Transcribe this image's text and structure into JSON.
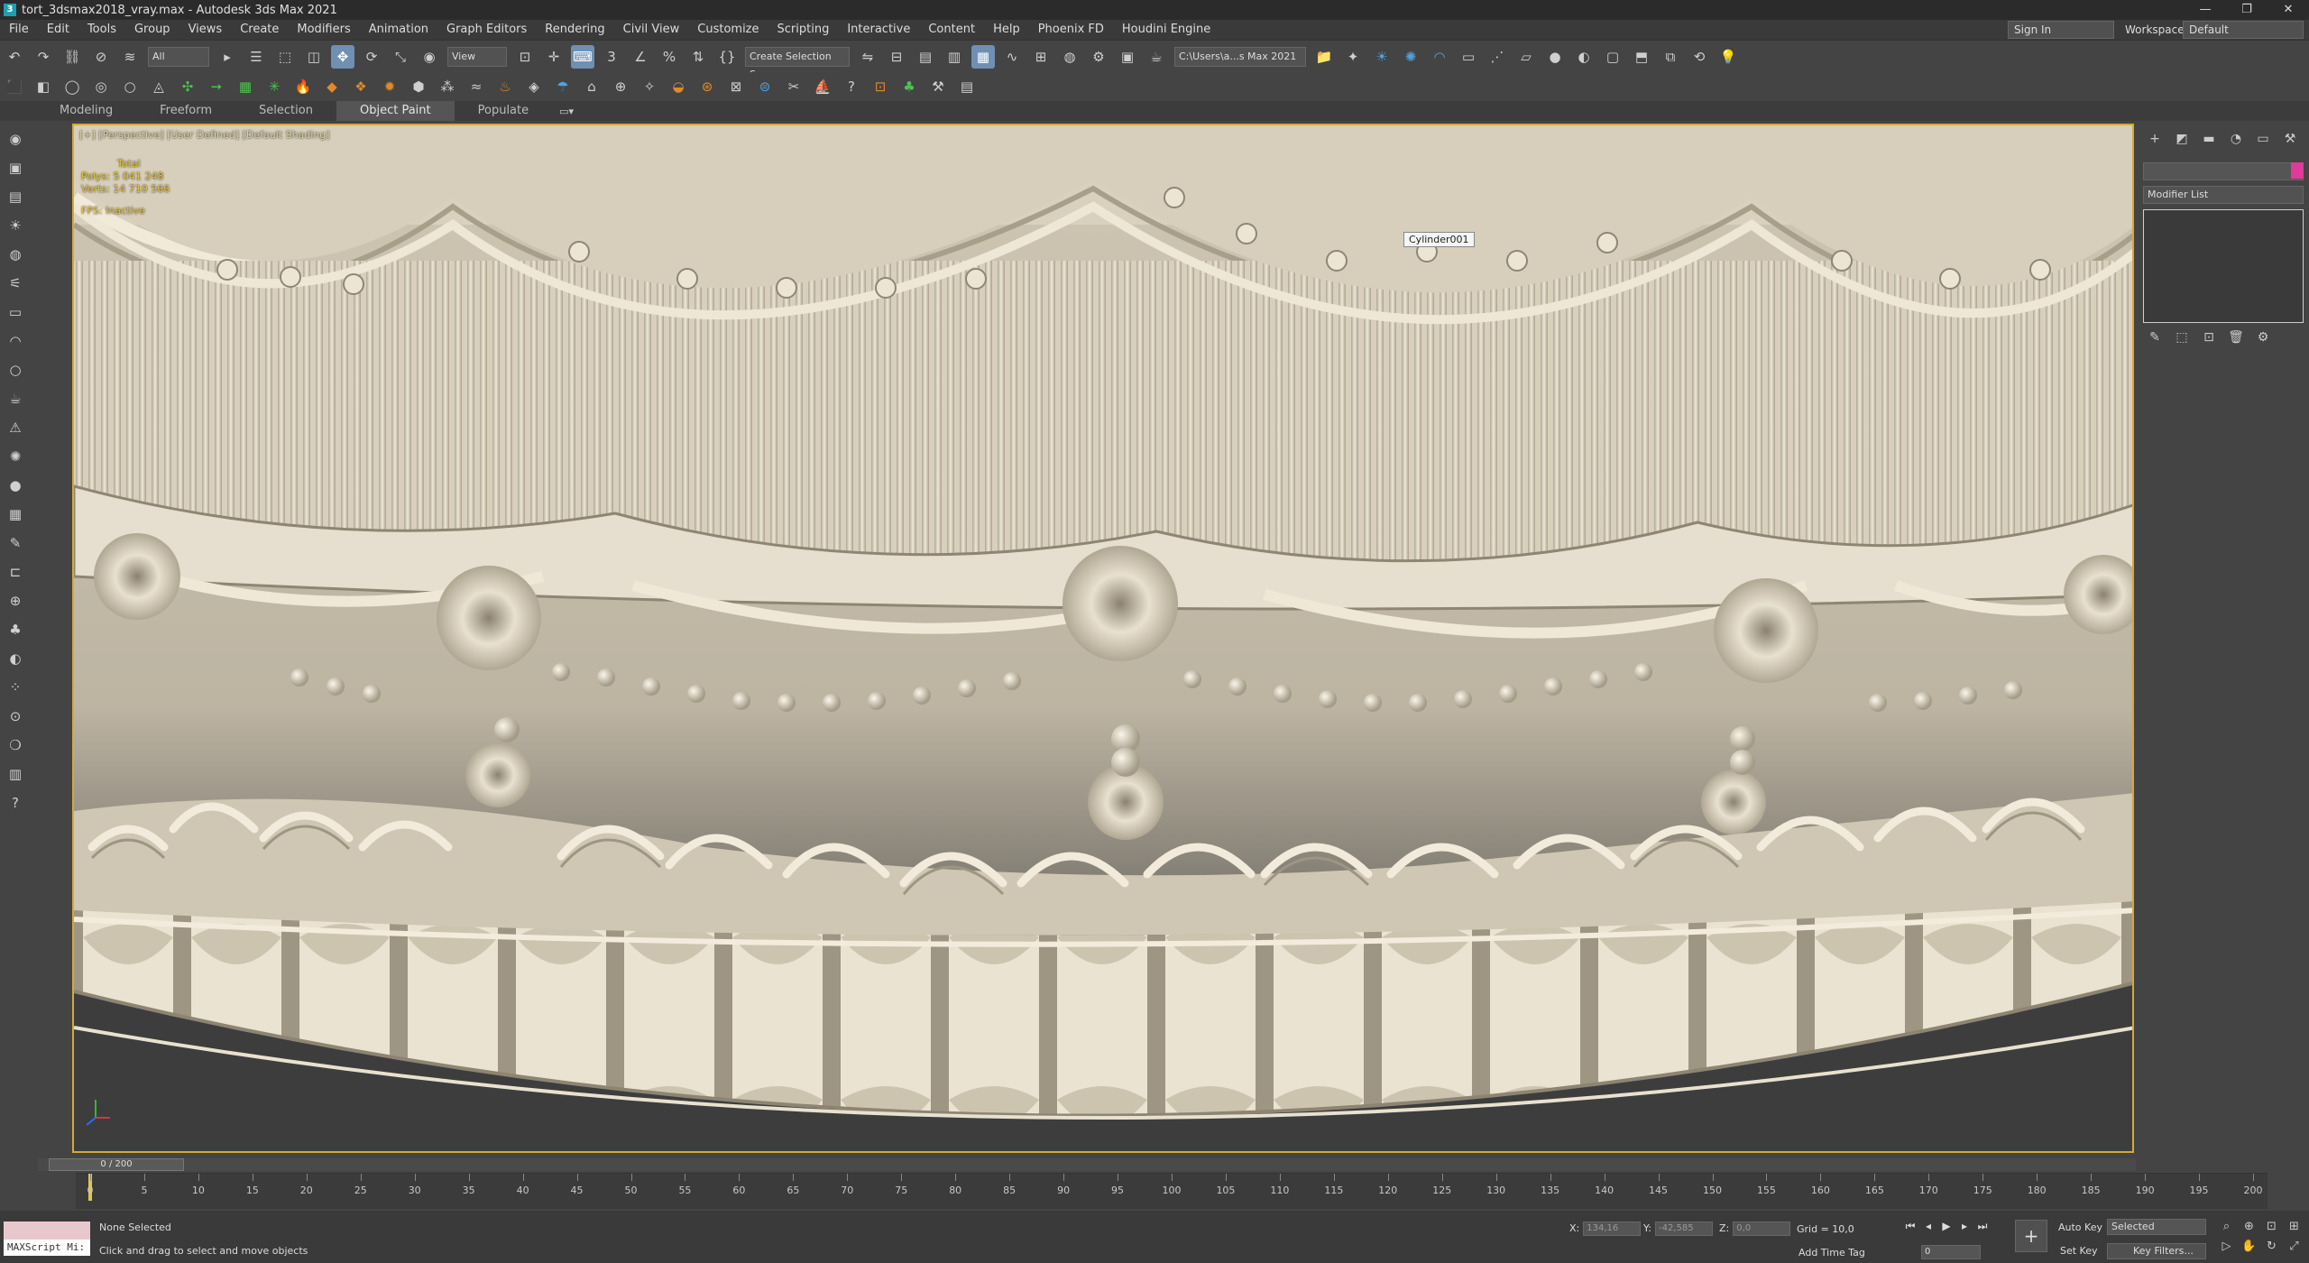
{
  "window": {
    "title": "tort_3dsmax2018_vray.max - Autodesk 3ds Max 2021",
    "controls": [
      "—",
      "❐",
      "✕"
    ]
  },
  "menu": [
    "File",
    "Edit",
    "Tools",
    "Group",
    "Views",
    "Create",
    "Modifiers",
    "Animation",
    "Graph Editors",
    "Rendering",
    "Civil View",
    "Customize",
    "Scripting",
    "Interactive",
    "Content",
    "Help",
    "Phoenix FD",
    "Houdini Engine"
  ],
  "account": {
    "signin": "Sign In",
    "workspaces_label": "Workspaces:",
    "workspace": "Default"
  },
  "toolbar": {
    "selection_filter": "All",
    "reference_coord": "View",
    "named_selection": "Create Selection Se",
    "project_path": "C:\\Users\\a...s Max 2021"
  },
  "ribbon": {
    "tabs": [
      "Modeling",
      "Freeform",
      "Selection",
      "Object Paint",
      "Populate"
    ],
    "active": "Object Paint"
  },
  "viewport": {
    "label": "[+] [Perspective] [User Defined] [Default Shading]",
    "stats": {
      "total_label": "Total",
      "polys_label": "Polys:",
      "polys_value": "5 041 248",
      "verts_label": "Verts:",
      "verts_value": "14 710 566",
      "fps_label": "FPS:",
      "fps_value": "Inactive"
    },
    "tooltip": "Cylinder001"
  },
  "command_panel": {
    "modifier_list": "Modifier List"
  },
  "timeline": {
    "frame_display": "0 / 200",
    "ticks": [
      "0",
      "5",
      "10",
      "15",
      "20",
      "25",
      "30",
      "35",
      "40",
      "45",
      "50",
      "55",
      "60",
      "65",
      "70",
      "75",
      "80",
      "85",
      "90",
      "95",
      "100",
      "105",
      "110",
      "115",
      "120",
      "125",
      "130",
      "135",
      "140",
      "145",
      "150",
      "155",
      "160",
      "165",
      "170",
      "175",
      "180",
      "185",
      "190",
      "195",
      "200"
    ]
  },
  "status": {
    "maxscript": "MAXScript Mi:",
    "selection": "None Selected",
    "hint": "Click and drag to select and move objects",
    "x_label": "X:",
    "x_value": "134,16",
    "y_label": "Y:",
    "y_value": "-42,585",
    "z_label": "Z:",
    "z_value": "0,0",
    "grid": "Grid = 10,0",
    "add_time_tag": "Add Time Tag",
    "frame": "0",
    "auto_key": "Auto Key",
    "set_key": "Set Key",
    "key_mode": "Selected",
    "key_filters": "Key Filters..."
  }
}
